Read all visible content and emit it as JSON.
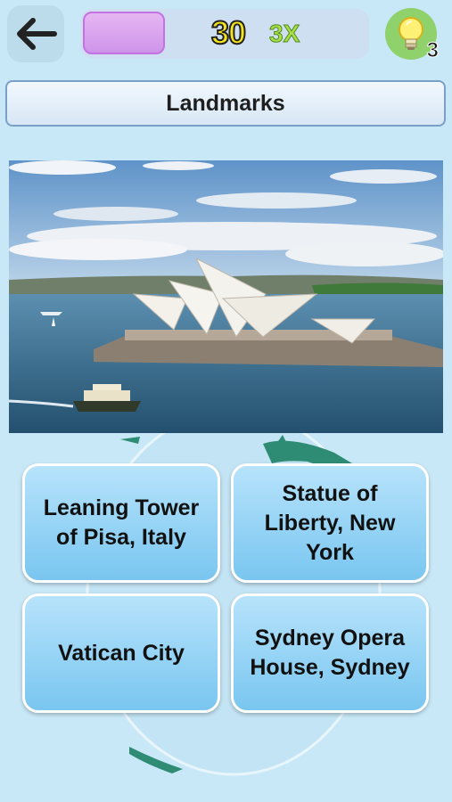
{
  "header": {
    "back_icon": "arrow-left-icon",
    "progress_fraction": 0.0,
    "score": "30",
    "multiplier": "3X",
    "hint_icon": "lightbulb-icon",
    "hint_count": "3"
  },
  "category": {
    "title": "Landmarks"
  },
  "answers": [
    {
      "label": "Leaning Tower of Pisa, Italy"
    },
    {
      "label": "Statue of Liberty, New York"
    },
    {
      "label": "Vatican City"
    },
    {
      "label": "Sydney Opera House, Sydney"
    }
  ],
  "colors": {
    "background": "#c8e8f8",
    "score_text": "#f3e51d",
    "multiplier_text": "#aae04a",
    "hint_button": "#8fd16b",
    "answer_fill": "#8fd0f3",
    "progress_box": "#d8a8ee"
  }
}
